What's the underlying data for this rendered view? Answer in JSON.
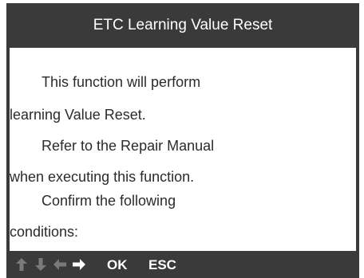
{
  "header": {
    "title": "ETC Learning Value Reset"
  },
  "body": {
    "lines": [
      "This function will perform",
      "learning Value Reset.",
      "Refer to the Repair Manual",
      "when executing this function.",
      "Confirm the following",
      "conditions:"
    ]
  },
  "footer": {
    "ok_label": "OK",
    "esc_label": "ESC",
    "icons": [
      "arrow-up-icon",
      "arrow-down-icon",
      "arrow-left-icon",
      "arrow-right-icon"
    ]
  },
  "colors": {
    "frame": "#3a3a3a",
    "content_background": "#ffffff",
    "text": "#2b2b2b",
    "disabled_icon": "#7a7a7a",
    "active_icon": "#ffffff"
  }
}
